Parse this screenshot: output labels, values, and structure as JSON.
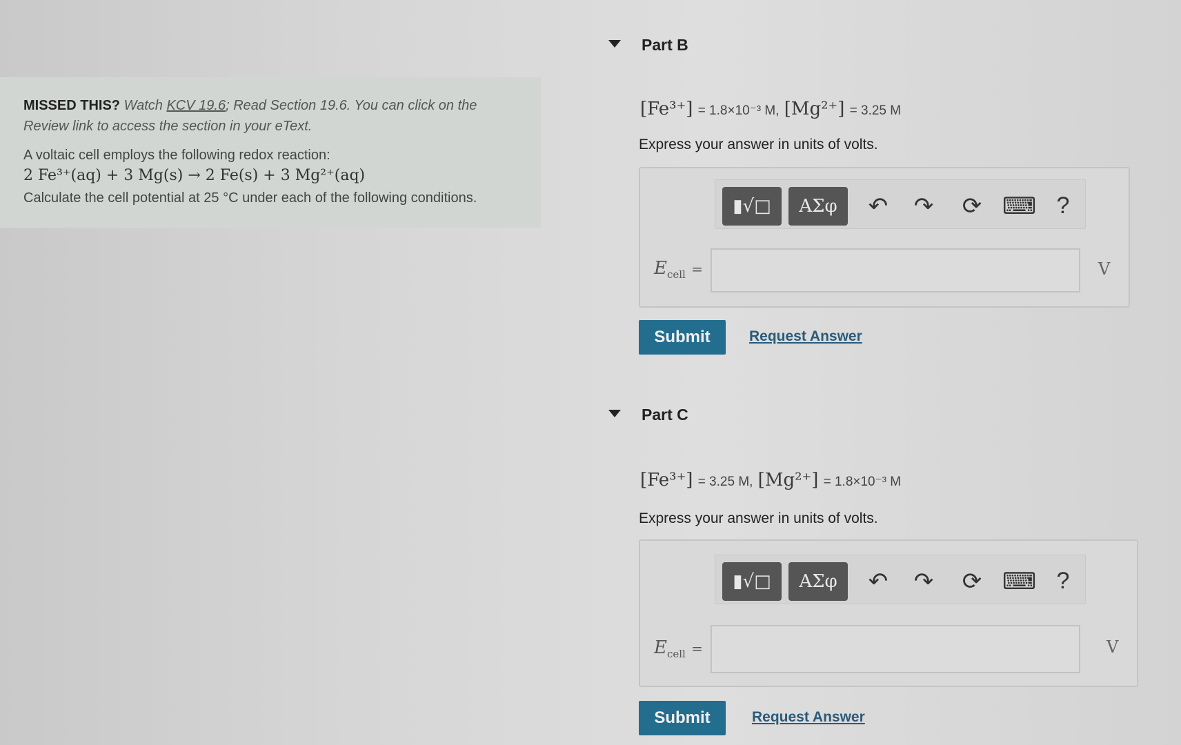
{
  "intro": {
    "missed_label": "MISSED THIS?",
    "missed_text_1": "Watch",
    "kcv_link": "KCV 19.6",
    "missed_text_2": "; Read Section 19.6. You can click on the Review link to access the section in your eText.",
    "reaction_intro": "A voltaic cell employs the following redox reaction:",
    "reaction": "2 Fe³⁺(aq) + 3 Mg(s) → 2 Fe(s) + 3 Mg²⁺(aq)",
    "question": "Calculate the cell potential at 25 °C under each of the following conditions."
  },
  "partB": {
    "title": "Part B",
    "cond_fe_label": "[Fe³⁺]",
    "cond_fe_value": "= 1.8×10⁻³ M",
    "cond_sep": ",",
    "cond_mg_label": "[Mg²⁺]",
    "cond_mg_value": "= 3.25 M",
    "express": "Express your answer in units of volts.",
    "ecell_symbol": "E",
    "ecell_sub": "cell",
    "ecell_eq": "=",
    "unit": "V",
    "submit": "Submit",
    "request": "Request Answer"
  },
  "partC": {
    "title": "Part C",
    "cond_fe_label": "[Fe³⁺]",
    "cond_fe_value": "= 3.25 M",
    "cond_sep": ",",
    "cond_mg_label": "[Mg²⁺]",
    "cond_mg_value": "= 1.8×10⁻³ M",
    "express": "Express your answer in units of volts.",
    "ecell_symbol": "E",
    "ecell_sub": "cell",
    "ecell_eq": "=",
    "unit": "V",
    "submit": "Submit",
    "request": "Request Answer"
  },
  "toolbar": {
    "templates_label": "▮√□",
    "symbols_label": "ΑΣφ",
    "undo": "↶",
    "redo": "↷",
    "reset": "⟳",
    "keyboard": "⌨",
    "help": "?"
  }
}
